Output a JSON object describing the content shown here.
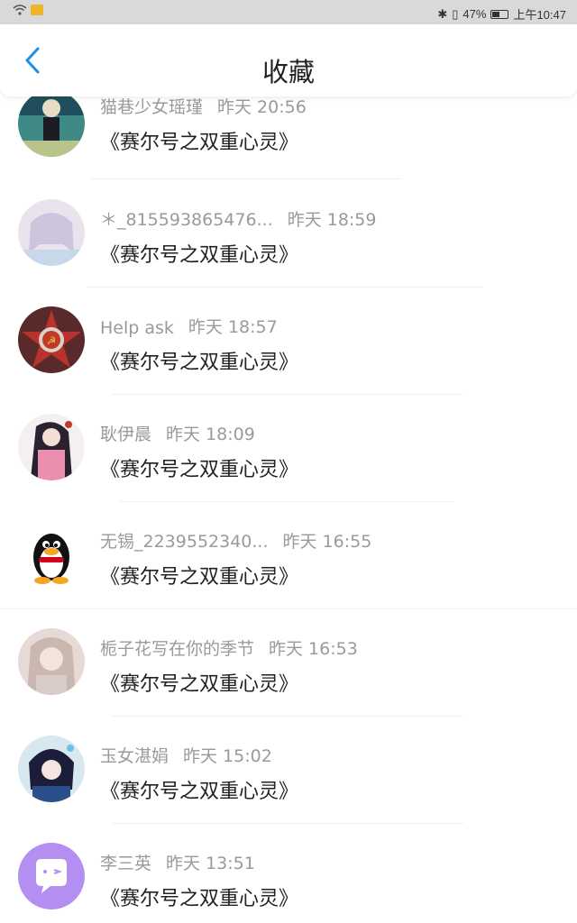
{
  "status_bar": {
    "battery": "47%",
    "time": "上午10:47"
  },
  "header": {
    "title": "收藏"
  },
  "colors": {
    "accent": "#1e8fe6"
  },
  "items": [
    {
      "name": "猫巷少女瑶瑾",
      "time": "昨天 20:56",
      "content": "《赛尔号之双重心灵》",
      "avatar": "anime-girl-dark"
    },
    {
      "name": "＊_815593865476...",
      "time": "昨天 18:59",
      "content": "《赛尔号之双重心灵》",
      "avatar": "anime-girl-pastel"
    },
    {
      "name": "Help ask",
      "time": "昨天 18:57",
      "content": "《赛尔号之双重心灵》",
      "avatar": "soviet-badge"
    },
    {
      "name": "耿伊晨",
      "time": "昨天 18:09",
      "content": "《赛尔号之双重心灵》",
      "avatar": "anime-girl-pink"
    },
    {
      "name": "无锡_2239552340...",
      "time": "昨天 16:55",
      "content": "《赛尔号之双重心灵》",
      "avatar": "qq-penguin"
    },
    {
      "name": "栀子花写在你的季节",
      "time": "昨天 16:53",
      "content": "《赛尔号之双重心灵》",
      "avatar": "girl-photo"
    },
    {
      "name": "玉女湛娟",
      "time": "昨天 15:02",
      "content": "《赛尔号之双重心灵》",
      "avatar": "anime-boy-blue"
    },
    {
      "name": "李三英",
      "time": "昨天 13:51",
      "content": "《赛尔号之双重心灵》",
      "avatar": "chat-bubble"
    }
  ]
}
